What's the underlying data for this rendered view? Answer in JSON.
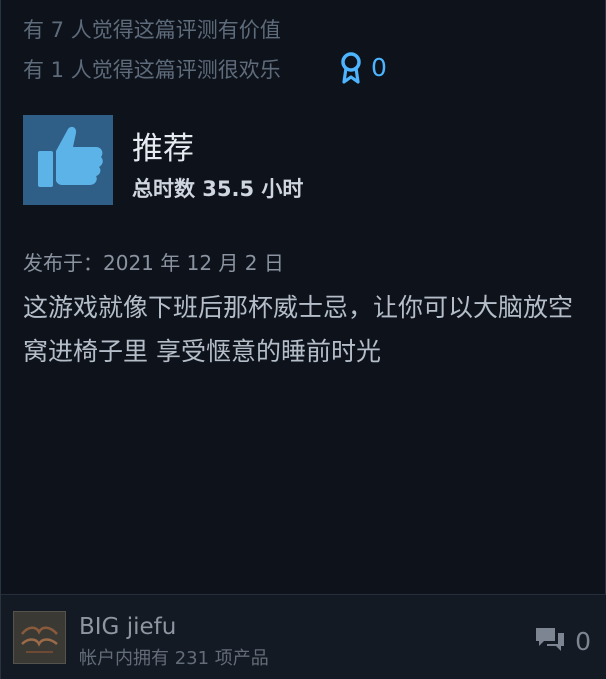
{
  "helpful": {
    "text": "有 7 人觉得这篇评测有价值"
  },
  "funny": {
    "text": "有 1 人觉得这篇评测很欢乐"
  },
  "award": {
    "icon": "award-ribbon-icon",
    "count": "0",
    "color": "#4db4ff"
  },
  "recommendation": {
    "icon": "thumbs-up-icon",
    "title": "推荐",
    "hours": "总时数 35.5 小时"
  },
  "posted": {
    "date": "发布于：2021 年 12 月 2 日"
  },
  "review": {
    "text": "这游戏就像下班后那杯威士忌，让你可以大脑放空 窝进椅子里 享受惬意的睡前时光"
  },
  "author": {
    "name": "BIG jiefu",
    "games": "帐户内拥有 231 项产品"
  },
  "comments": {
    "icon": "comment-bubbles-icon",
    "count": "0"
  }
}
